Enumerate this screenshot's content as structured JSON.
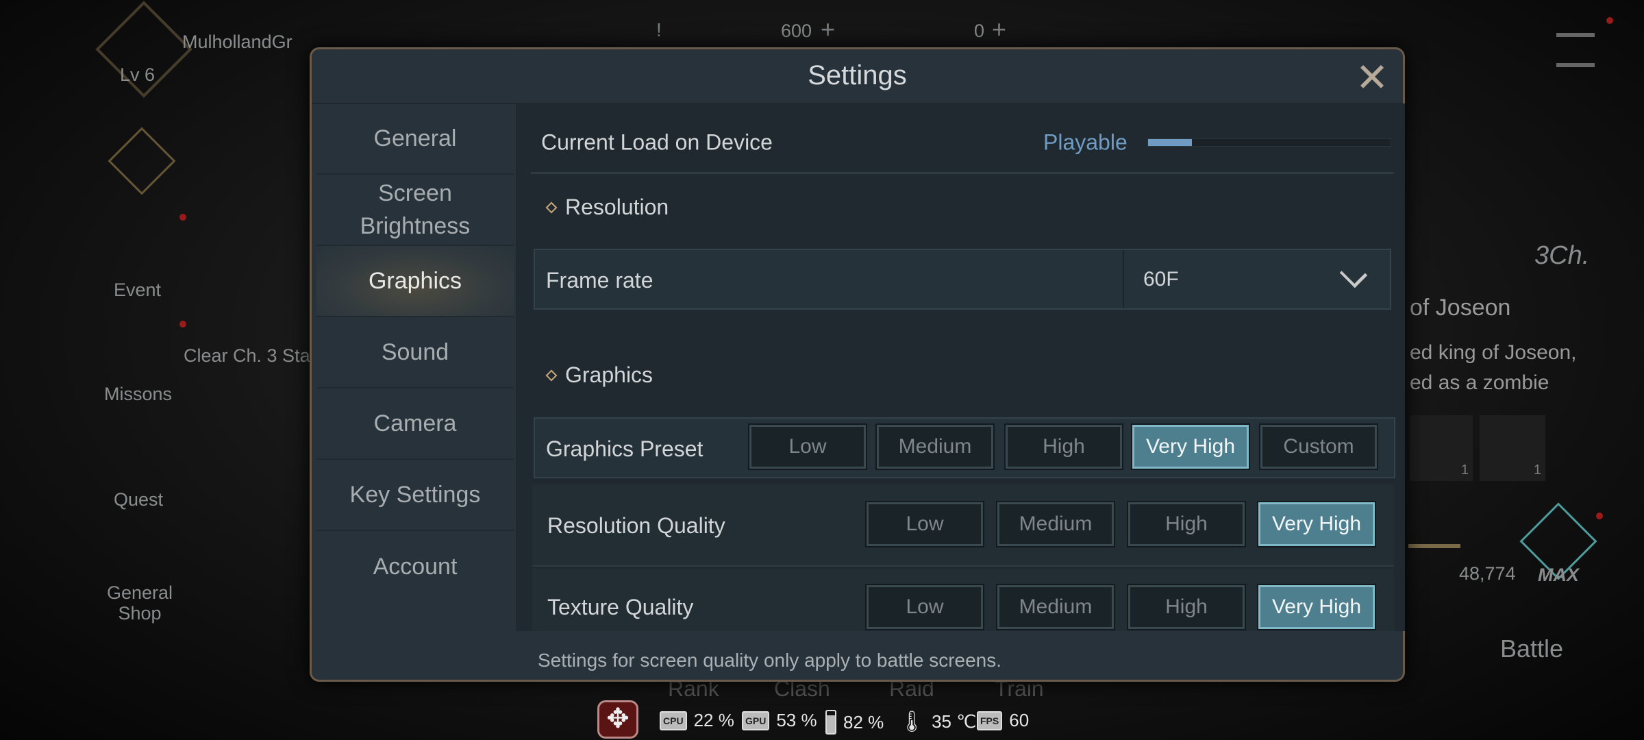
{
  "hud": {
    "player_name": "MulhollandGr",
    "level": "Lv 6",
    "currency_1": "600",
    "currency_2": "0",
    "plus": "+",
    "alert": "!",
    "side_menu": [
      "Event",
      "Missons",
      "Quest",
      "General\nShop"
    ],
    "mission_text": "Clear Ch. 3 Sta",
    "chapter": "3Ch.",
    "boss_title": "of Joseon",
    "boss_desc_1": "ed king of Joseon,",
    "boss_desc_2": "ed as a zombie",
    "reward_counts": [
      "1",
      "1"
    ],
    "power": "48,774",
    "max_badge": "MAX",
    "battle_label": "Battle",
    "bottom_tabs": [
      "Rank",
      "Clash",
      "Raid",
      "Train"
    ]
  },
  "settings": {
    "title": "Settings",
    "nav": [
      {
        "label": "General",
        "selected": false
      },
      {
        "label": "Screen\nBrightness",
        "selected": false
      },
      {
        "label": "Graphics",
        "selected": true
      },
      {
        "label": "Sound",
        "selected": false
      },
      {
        "label": "Camera",
        "selected": false
      },
      {
        "label": "Key Settings",
        "selected": false
      },
      {
        "label": "Account",
        "selected": false
      }
    ],
    "load": {
      "label": "Current Load on Device",
      "status": "Playable",
      "level_fraction": 0.18,
      "status_color": "#6f9cc4"
    },
    "resolution_header": "Resolution",
    "frame_rate": {
      "label": "Frame rate",
      "value": "60F"
    },
    "graphics_header": "Graphics",
    "preset": {
      "label": "Graphics Preset",
      "options": [
        "Low",
        "Medium",
        "High",
        "Very High",
        "Custom"
      ],
      "selected": "Very High"
    },
    "resolution_quality": {
      "label": "Resolution Quality",
      "options": [
        "Low",
        "Medium",
        "High",
        "Very High"
      ],
      "selected": "Very High"
    },
    "texture_quality": {
      "label": "Texture Quality",
      "options": [
        "Low",
        "Medium",
        "High",
        "Very High"
      ],
      "selected": "Very High"
    },
    "footer_note": "Settings for screen quality only apply to battle screens."
  },
  "perf": {
    "cpu_label": "CPU",
    "cpu": "22 %",
    "gpu_label": "GPU",
    "gpu": "53 %",
    "battery": "82 %",
    "temp": "35 ℃",
    "fps_label": "FPS",
    "fps": "60"
  },
  "colors": {
    "accent": "#4d7f8e",
    "frame": "#6b5a47",
    "move_button": "#5a1414"
  }
}
